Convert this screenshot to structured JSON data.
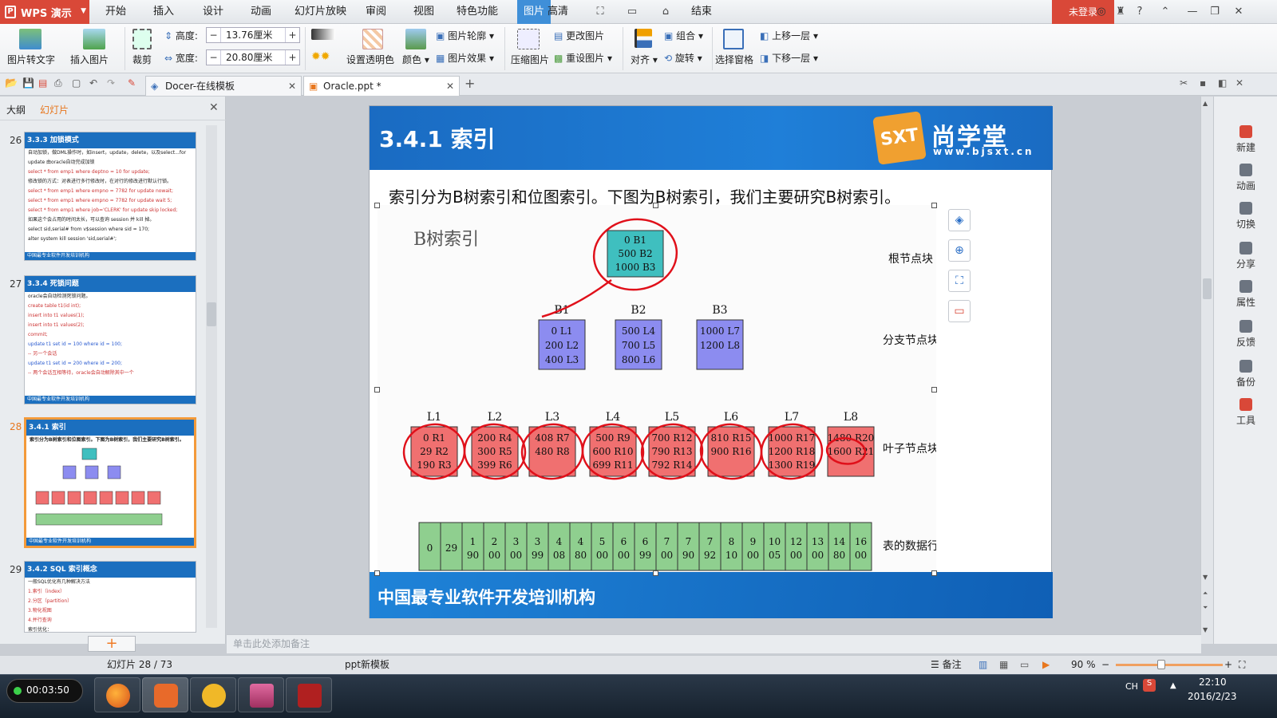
{
  "app": {
    "name": "WPS 演示",
    "login": "未登录"
  },
  "menu": [
    "开始",
    "插入",
    "设计",
    "动画",
    "幻灯片放映",
    "审阅",
    "视图",
    "特色功能",
    "图片",
    "高清",
    "结束"
  ],
  "active_menu_index": 8,
  "ribbon": {
    "pic_to_text": "图片转文字",
    "insert_pic": "插入图片",
    "crop": "裁剪",
    "height_label": "高度:",
    "height_value": "13.76厘米",
    "width_label": "宽度:",
    "width_value": "20.80厘米",
    "transparent": "设置透明色",
    "color": "颜色",
    "outline": "图片轮廓",
    "effect": "图片效果",
    "compress": "压缩图片",
    "change_pic": "更改图片",
    "reset_pic": "重设图片",
    "align": "对齐",
    "group": "组合",
    "rotate": "旋转",
    "selection_pane": "选择窗格",
    "bring_forward": "上移一层",
    "send_backward": "下移一层"
  },
  "tabs": [
    {
      "label": "Docer-在线模板"
    },
    {
      "label": "Oracle.ppt *"
    }
  ],
  "left_panel": {
    "tab_outline": "大纲",
    "tab_slides": "幻灯片",
    "thumbs": [
      {
        "num": "26",
        "title": "3.3.3 加锁模式",
        "lines": [
          "自动加锁，做DML操作时，如insert，update，delete，以及select...for",
          "update 由oracle自动完成加锁",
          "select * from emp1 where deptno = 10 for update;",
          "修改锁的方式：对表进行多行修改时，在对行的修改进行默认行锁。",
          "select * from emp1 where empno = 7782 for update nowait;",
          "select * from emp1 where empno = 7782 for update wait 5;",
          "select * from emp1 where job='CLERK' for update skip locked;",
          "如果这个会占用的时间太长，可以查询 session 并 kill 掉。",
          "select sid,serial# from v$session where sid = 170;",
          "alter system kill session 'sid,serial#';"
        ],
        "footer": "中国最专业软件开发培训机构"
      },
      {
        "num": "27",
        "title": "3.3.4 死锁问题",
        "lines": [
          "oracle会自动检测死锁问题。",
          "create table t1(id int);",
          "insert into t1 values(1);",
          "insert into t1 values(2);",
          "commit;",
          "update t1 set id = 100 where id = 100;",
          "-- 另一个会话",
          "update t1 set id = 200 where id = 200;",
          "-- 两个会话互相等待，oracle会自动解除其中一个"
        ],
        "footer": "中国最专业软件开发培训机构"
      },
      {
        "num": "28",
        "title": "3.4.1 索引",
        "lines": [
          "索引分为B树索引和位图索引。下图为B树索引，我们主要研究B树索引。"
        ],
        "footer": "中国最专业软件开发培训机构"
      },
      {
        "num": "29",
        "title": "3.4.2 SQL 索引概念",
        "lines": [
          "一般SQL优化有几种解决方法",
          "1.索引（index）",
          "2.分区（partition）",
          "3.物化视图",
          "4.并行查询",
          "索引优化："
        ],
        "footer": ""
      }
    ]
  },
  "slide": {
    "title": "3.4.1 索引",
    "brand": "尚学堂",
    "brand_url": "www.bjsxt.cn",
    "brand_logo": "SXT",
    "description": "索引分为B树索引和位图索引。下图为B树索引，我们主要研究B树索引。",
    "footer": "中国最专业软件开发培训机构"
  },
  "diagram": {
    "title": "B树索引",
    "labels": {
      "root": "根节点块",
      "branch": "分支节点块",
      "leaf": "叶子节点块",
      "rows": "表的数据行"
    },
    "root": {
      "lines": [
        "0 B1",
        "500 B2",
        "1000 B3"
      ]
    },
    "branches": [
      {
        "name": "B1",
        "lines": [
          "0 L1",
          "200 L2",
          "400 L3"
        ]
      },
      {
        "name": "B2",
        "lines": [
          "500 L4",
          "700 L5",
          "800 L6"
        ]
      },
      {
        "name": "B3",
        "lines": [
          "1000 L7",
          "1200 L8"
        ]
      }
    ],
    "leaves": [
      {
        "name": "L1",
        "lines": [
          "0 R1",
          "29 R2",
          "190 R3"
        ]
      },
      {
        "name": "L2",
        "lines": [
          "200 R4",
          "300 R5",
          "399 R6"
        ]
      },
      {
        "name": "L3",
        "lines": [
          "408 R7",
          "480 R8"
        ]
      },
      {
        "name": "L4",
        "lines": [
          "500 R9",
          "600 R10",
          "699 R11"
        ]
      },
      {
        "name": "L5",
        "lines": [
          "700 R12",
          "790 R13",
          "792 R14"
        ]
      },
      {
        "name": "L6",
        "lines": [
          "810 R15",
          "900 R16"
        ]
      },
      {
        "name": "L7",
        "lines": [
          "1000 R17",
          "1200 R18",
          "1300 R19"
        ]
      },
      {
        "name": "L8",
        "lines": [
          "1480 R20",
          "1600 R21"
        ]
      }
    ],
    "rows": [
      "0",
      "29",
      "190",
      "200",
      "300",
      "399",
      "408",
      "480",
      "500",
      "600",
      "699",
      "700",
      "790",
      "792",
      "810",
      "900",
      "1005",
      "1200",
      "1300",
      "1480",
      "1600"
    ]
  },
  "right_bar": [
    "新建",
    "动画",
    "切换",
    "分享",
    "属性",
    "反馈",
    "备份",
    "工具"
  ],
  "notes_placeholder": "单击此处添加备注",
  "status": {
    "slide_info": "幻灯片 28 / 73",
    "template": "ppt新模板",
    "notes_btn": "备注",
    "zoom": "90 %"
  },
  "taskbar": {
    "recorder_time": "00:03:50",
    "time": "22:10",
    "date": "2016/2/23",
    "ime": "CH"
  },
  "colors": {
    "accent": "#1b6fbf",
    "wps_red": "#d94838",
    "root_fill": "#3fbfbf",
    "branch_fill": "#8c8cf0",
    "leaf_fill": "#f07070",
    "row_fill": "#8fcf8f",
    "annotation": "#e0101a"
  }
}
